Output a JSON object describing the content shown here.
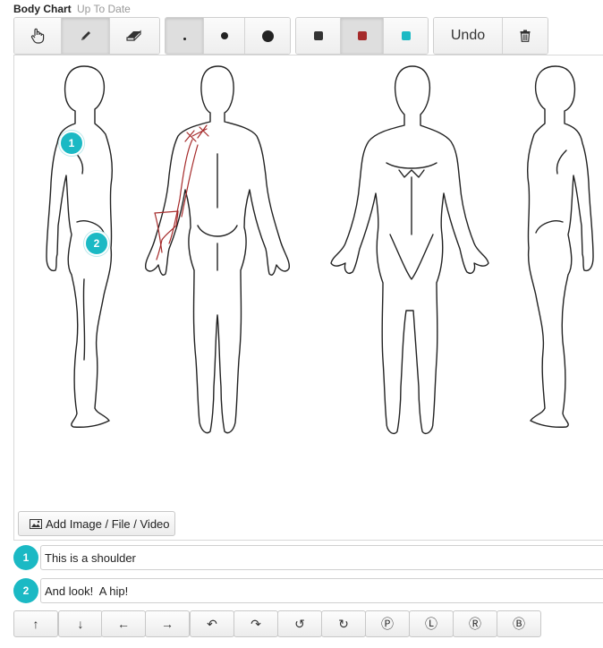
{
  "header": {
    "title": "Body Chart",
    "status": "Up To Date"
  },
  "toolbar": {
    "undo_label": "Undo",
    "tools": [
      "hand-pointer-icon",
      "pencil-icon",
      "eraser-icon"
    ],
    "active_tool": "pencil-icon",
    "brush_sizes": [
      "small",
      "medium",
      "large"
    ],
    "active_size": "small",
    "colors": [
      "#333333",
      "#a52a2a",
      "#1bb9c4"
    ],
    "active_color": "#a52a2a"
  },
  "canvas": {
    "pins": [
      {
        "label": "1"
      },
      {
        "label": "2"
      }
    ],
    "add_media_label": "Add Image / File / Video"
  },
  "notes": [
    {
      "number": "1",
      "text": "This is a shoulder"
    },
    {
      "number": "2",
      "text": "And look!  A hip!"
    }
  ],
  "symbols": [
    "↑",
    "↓",
    "←",
    "→",
    "↶",
    "↷",
    "↺",
    "↻",
    "Ⓟ",
    "Ⓛ",
    "Ⓡ",
    "Ⓑ"
  ],
  "colors": {
    "accent": "#1bb9c4",
    "drawing": "#a52a2a"
  }
}
